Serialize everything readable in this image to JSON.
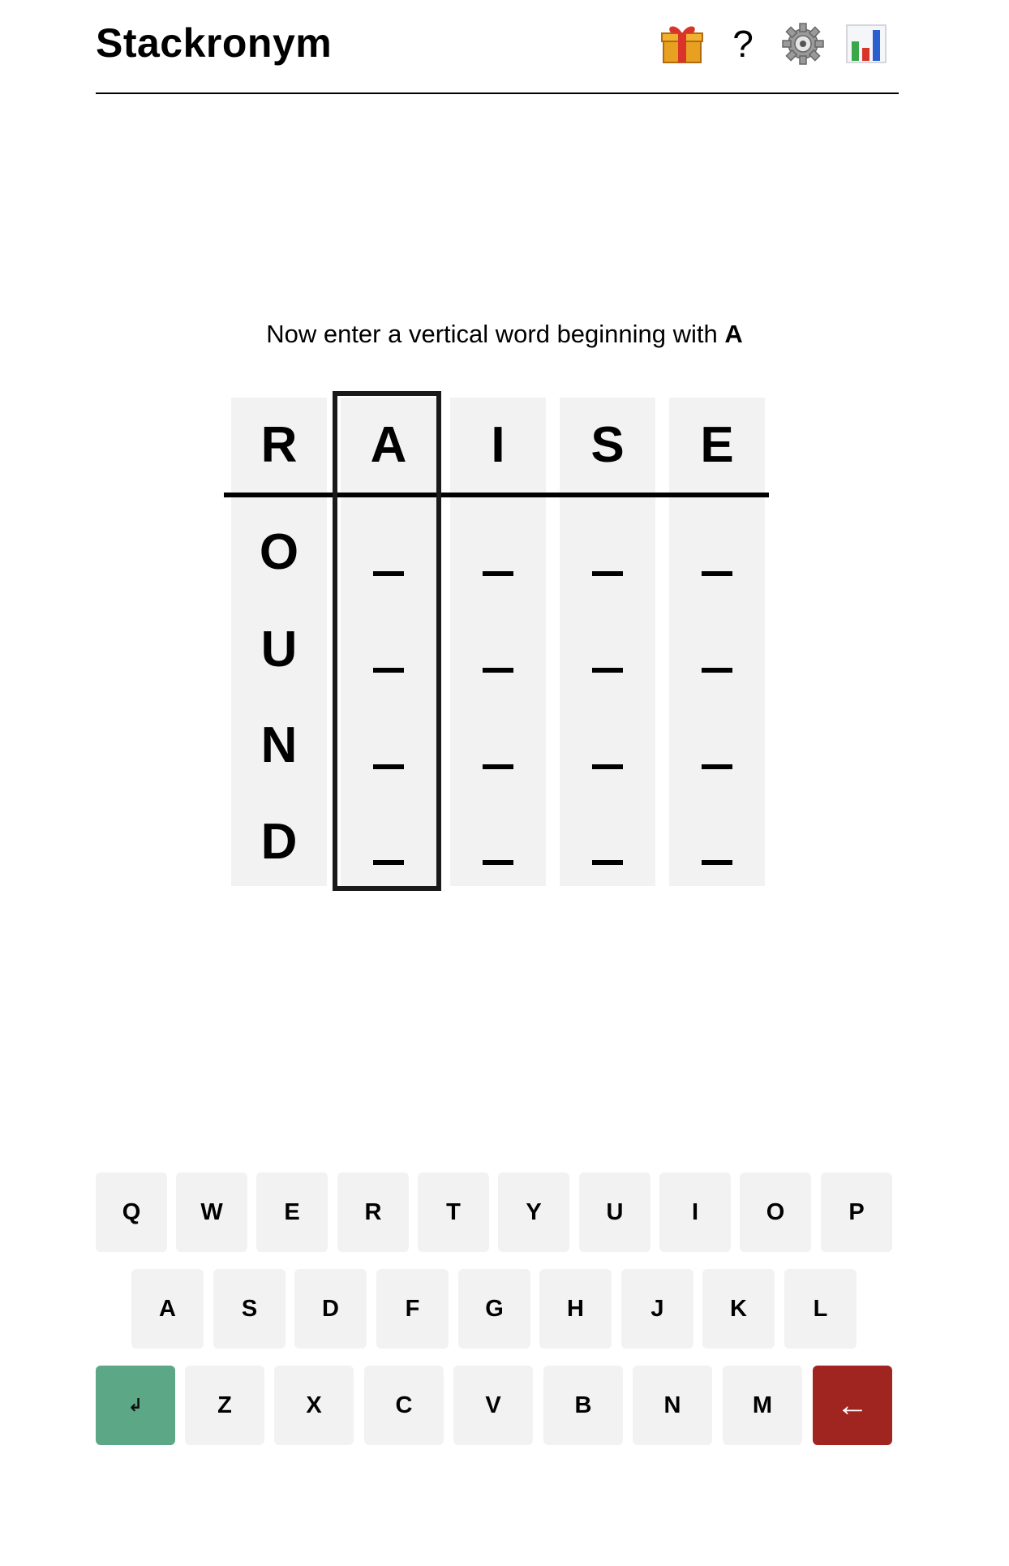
{
  "app": {
    "title": "Stackronym"
  },
  "header_icons": [
    {
      "name": "gift-icon",
      "label": "🎁"
    },
    {
      "name": "help-icon",
      "label": "?"
    },
    {
      "name": "settings-gear-icon",
      "label": "⚙"
    },
    {
      "name": "stats-chart-icon",
      "label": "📊"
    }
  ],
  "prompt": {
    "text": "Now enter a vertical word beginning with ",
    "letter": "A"
  },
  "board": {
    "columns": [
      {
        "header": "R",
        "cells": [
          "O",
          "U",
          "N",
          "D"
        ]
      },
      {
        "header": "A",
        "cells": [
          "_",
          "_",
          "_",
          "_"
        ]
      },
      {
        "header": "I",
        "cells": [
          "_",
          "_",
          "_",
          "_"
        ]
      },
      {
        "header": "S",
        "cells": [
          "_",
          "_",
          "_",
          "_"
        ]
      },
      {
        "header": "E",
        "cells": [
          "_",
          "_",
          "_",
          "_"
        ]
      }
    ],
    "active_column": 1
  },
  "keyboard": {
    "rows": [
      [
        "Q",
        "W",
        "E",
        "R",
        "T",
        "Y",
        "U",
        "I",
        "O",
        "P"
      ],
      [
        "A",
        "S",
        "D",
        "F",
        "G",
        "H",
        "J",
        "K",
        "L"
      ],
      [
        "↲",
        "Z",
        "X",
        "C",
        "V",
        "B",
        "N",
        "M",
        "←"
      ]
    ]
  },
  "colors": {
    "enter_key": "#5ba786",
    "backspace_key": "#a0241f",
    "tile_bg": "#f2f2f2"
  }
}
